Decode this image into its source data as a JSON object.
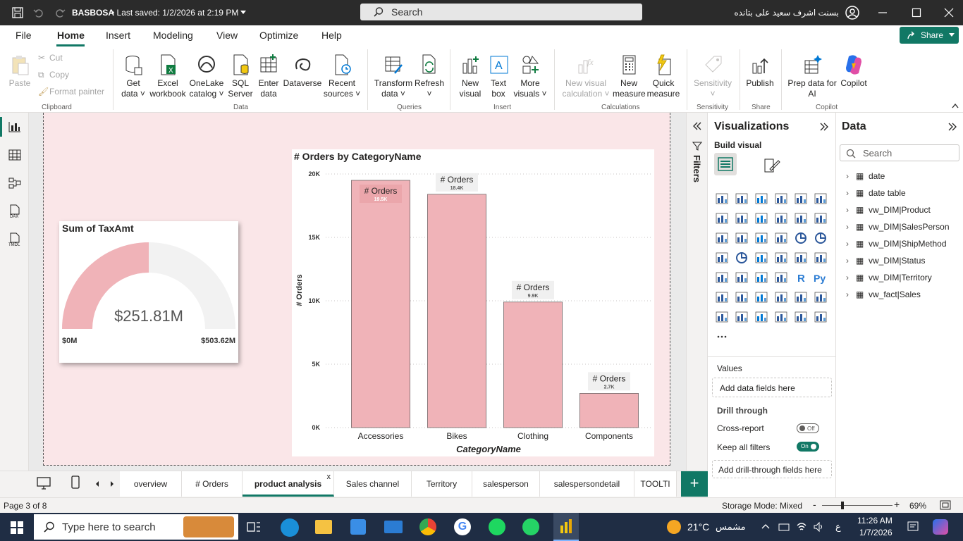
{
  "titlebar": {
    "file_name": "BASBOSA",
    "save_status": "• Last saved: 1/2/2026 at 2:19 PM",
    "search_placeholder": "Search",
    "user_name": "بسنت اشرف سعيد على بتانده"
  },
  "ribbon_tabs": [
    "File",
    "Home",
    "Insert",
    "Modeling",
    "View",
    "Optimize",
    "Help"
  ],
  "share_label": "Share",
  "ribbon": {
    "paste": "Paste",
    "cut": "Cut",
    "copy": "Copy",
    "format_painter": "Format painter",
    "get_data": "Get",
    "get_data2": "data",
    "excel": "Excel",
    "excel2": "workbook",
    "onelake": "OneLake",
    "onelake2": "catalog",
    "sql": "SQL",
    "sql2": "Server",
    "enter": "Enter",
    "enter2": "data",
    "dataverse": "Dataverse",
    "recent": "Recent",
    "recent2": "sources",
    "transform": "Transform",
    "transform2": "data",
    "refresh": "Refresh",
    "new_visual": "New",
    "new_visual2": "visual",
    "text_box": "Text",
    "text_box2": "box",
    "more_visuals": "More",
    "more_visuals2": "visuals",
    "new_vcalc": "New visual",
    "new_vcalc2": "calculation",
    "new_measure": "New",
    "new_measure2": "measure",
    "quick": "Quick",
    "quick2": "measure",
    "sensitivity": "Sensitivity",
    "publish": "Publish",
    "prep": "Prep data for",
    "prep2": "AI",
    "copilot": "Copilot",
    "groups": {
      "clipboard": "Clipboard",
      "data": "Data",
      "queries": "Queries",
      "insert": "Insert",
      "calculations": "Calculations",
      "sensitivity": "Sensitivity",
      "share": "Share",
      "copilot": "Copilot"
    }
  },
  "gauge": {
    "title": "Sum of TaxAmt",
    "value_label": "$251.81M",
    "min_label": "$0M",
    "max_label": "$503.62M",
    "value": 251.81,
    "min": 0,
    "max": 503.62,
    "fill_color": "#f0b3b8",
    "track_color": "#f2f2f2"
  },
  "chart_data": {
    "type": "bar",
    "title": "# Orders by CategoryName",
    "xlabel": "CategoryName",
    "ylabel": "# Orders",
    "categories": [
      "Accessories",
      "Bikes",
      "Clothing",
      "Components"
    ],
    "values": [
      19500,
      18400,
      9900,
      2700
    ],
    "data_labels": [
      "19.5K",
      "18.4K",
      "9.9K",
      "2.7K"
    ],
    "tooltip_label": "# Orders",
    "yticks": [
      0,
      5000,
      10000,
      15000,
      20000
    ],
    "ytick_labels": [
      "0K",
      "5K",
      "10K",
      "15K",
      "20K"
    ],
    "ylim": [
      0,
      20000
    ],
    "bar_color": "#f0b3b8",
    "grid": true
  },
  "filters_label": "Filters",
  "viz": {
    "title": "Visualizations",
    "build_visual": "Build visual",
    "values_label": "Values",
    "add_fields": "Add data fields here",
    "drill_through": "Drill through",
    "cross_report": "Cross-report",
    "cross_report_state": "Off",
    "keep_filters": "Keep all filters",
    "keep_filters_state": "On",
    "add_drill": "Add drill-through fields here",
    "more": "···"
  },
  "data_pane": {
    "title": "Data",
    "search_placeholder": "Search",
    "tables": [
      "date",
      "date table",
      "vw_DIM|Product",
      "vw_DIM|SalesPerson",
      "vw_DIM|ShipMethod",
      "vw_DIM|Status",
      "vw_DIM|Territory",
      "vw_fact|Sales"
    ]
  },
  "page_tabs": [
    "overview",
    "# Orders",
    "product analysis",
    "Sales channel",
    "Territory",
    "salesperson",
    "salespersondetail",
    "TOOLTI"
  ],
  "status": {
    "page": "Page 3 of 8",
    "storage": "Storage Mode: Mixed",
    "zoom": "69%"
  },
  "taskbar": {
    "search_placeholder": "Type here to search",
    "temperature": "21°C",
    "weather": "مشمس",
    "time": "11:26 AM",
    "date": "1/7/2026",
    "lang": "ع"
  }
}
